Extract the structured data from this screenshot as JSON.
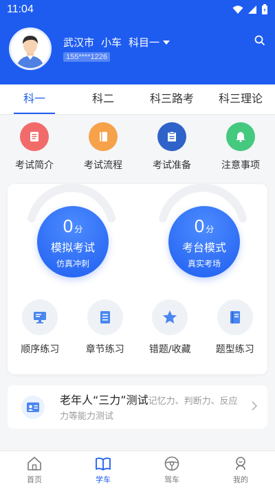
{
  "status_bar": {
    "time": "11:04"
  },
  "header": {
    "city": "武汉市",
    "vehicle": "小车",
    "subject": "科目一",
    "phone": "155****1226"
  },
  "tabs": [
    {
      "label": "科一"
    },
    {
      "label": "科二"
    },
    {
      "label": "科三路考"
    },
    {
      "label": "科三理论"
    }
  ],
  "quick_links": [
    {
      "label": "考试简介",
      "color": "#f26b6b",
      "icon": "document-icon"
    },
    {
      "label": "考试流程",
      "color": "#f5a24a",
      "icon": "book-icon"
    },
    {
      "label": "考试准备",
      "color": "#2f63c9",
      "icon": "checklist-icon"
    },
    {
      "label": "注意事项",
      "color": "#45c97e",
      "icon": "bell-icon"
    }
  ],
  "exams": [
    {
      "score": "0",
      "unit": "分",
      "name": "模拟考试",
      "sub": "仿真冲刺"
    },
    {
      "score": "0",
      "unit": "分",
      "name": "考台模式",
      "sub": "真实考场"
    }
  ],
  "practice": [
    {
      "label": "顺序练习",
      "icon": "monitor-icon"
    },
    {
      "label": "章节练习",
      "icon": "chapter-list-icon"
    },
    {
      "label": "错题/收藏",
      "icon": "star-icon"
    },
    {
      "label": "题型练习",
      "icon": "book-type-icon"
    }
  ],
  "elder_test": {
    "title": "老年人“三力”测试",
    "desc": "记忆力、判断力、反应力等能力测试"
  },
  "bottom_nav": [
    {
      "label": "首页",
      "icon": "home-icon"
    },
    {
      "label": "学车",
      "icon": "study-book-icon"
    },
    {
      "label": "驾车",
      "icon": "steering-wheel-icon"
    },
    {
      "label": "我的",
      "icon": "profile-icon"
    }
  ],
  "colors": {
    "primary": "#1e5cf0"
  }
}
